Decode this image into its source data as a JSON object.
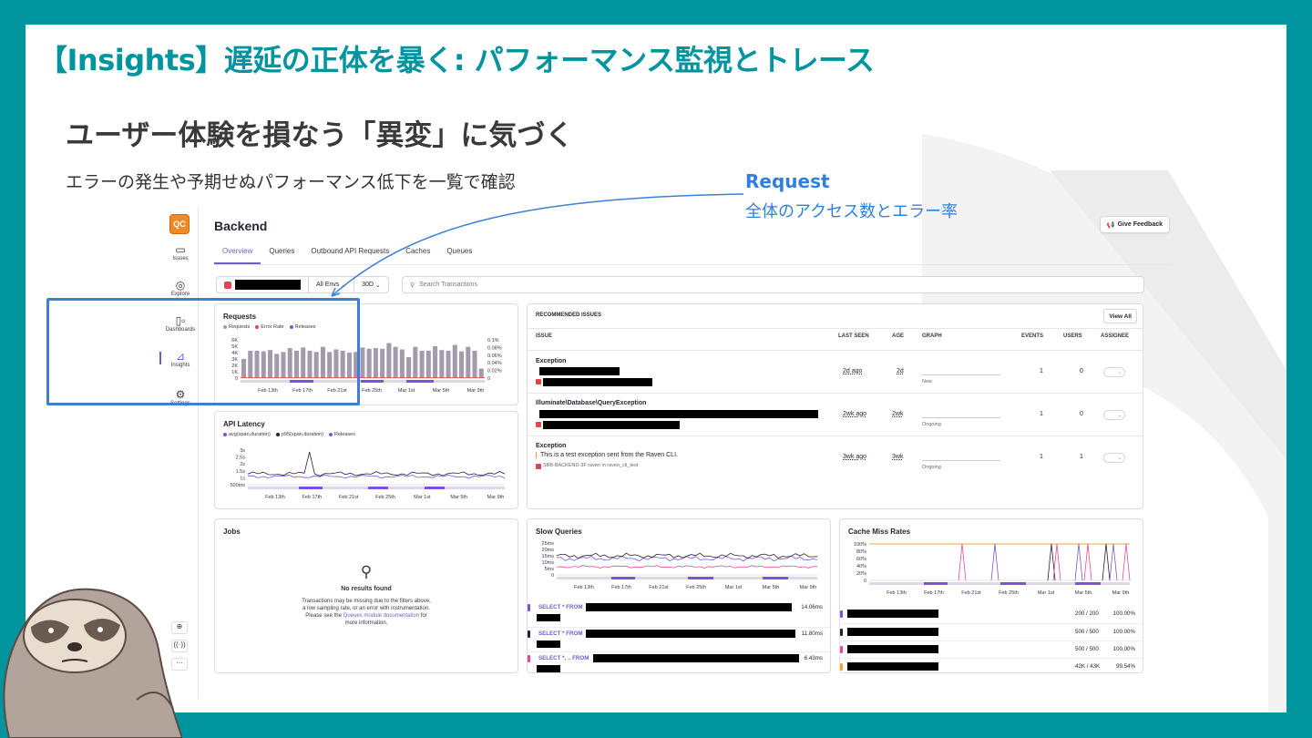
{
  "slide": {
    "title": "【Insights】遅延の正体を暴く: パフォーマンス監視とトレース",
    "subtitle": "ユーザー体験を損なう「異変」に気づく",
    "description": "エラーの発生や予期せぬパフォーマンス低下を一覧で確認",
    "callout_title": "Request",
    "callout_sub": "全体のアクセス数とエラー率",
    "accent_color": "#00949f",
    "callout_color": "#2f7fe0"
  },
  "sidebar": {
    "logo": "QC",
    "items": [
      {
        "label": "Issues",
        "icon": "inbox-icon"
      },
      {
        "label": "Explore",
        "icon": "compass-icon"
      },
      {
        "label": "Dashboards",
        "icon": "dashboard-icon"
      },
      {
        "label": "Insights",
        "icon": "chart-icon"
      },
      {
        "label": "Settings",
        "icon": "gear-icon"
      }
    ],
    "bottom_icons": [
      "help-icon",
      "broadcast-icon",
      "more-icon"
    ]
  },
  "header": {
    "title": "Backend",
    "feedback": "Give Feedback",
    "tabs": [
      "Overview",
      "Queries",
      "Outbound API Requests",
      "Caches",
      "Queues"
    ]
  },
  "filters": {
    "env": "All Envs",
    "period": "30D",
    "search_placeholder": "Search Transactions"
  },
  "requests_panel": {
    "title": "Requests",
    "legend": [
      "Requests",
      "Error Rate",
      "Releases"
    ]
  },
  "latency_panel": {
    "title": "API Latency",
    "legend": [
      "avg(span.duration)",
      "p95(span.duration)",
      "Releases"
    ]
  },
  "issues_panel": {
    "title": "RECOMMENDED ISSUES",
    "view_all": "View All",
    "headers": [
      "ISSUE",
      "LAST SEEN",
      "AGE",
      "GRAPH",
      "EVENTS",
      "USERS",
      "ASSIGNEE"
    ],
    "rows": [
      {
        "title": "Exception",
        "message": "",
        "meta": "",
        "last_seen": "2d ago",
        "age": "2d",
        "status": "New",
        "events": "1",
        "users": "0"
      },
      {
        "title": "Illuminate\\Database\\QueryException",
        "message": "",
        "meta": "",
        "last_seen": "2wk ago",
        "age": "2wk",
        "status": "Ongoing",
        "events": "1",
        "users": "0"
      },
      {
        "title": "Exception",
        "message": "This is a test exception sent from the Raven CLI.",
        "meta": "SBB-BACKEND-3F  raven in raven_cli_test",
        "last_seen": "3wk ago",
        "age": "3wk",
        "status": "Ongoing",
        "events": "1",
        "users": "1"
      }
    ]
  },
  "jobs_panel": {
    "title": "Jobs",
    "empty_title": "No results found",
    "empty_line1": "Transactions may be missing due to the filters above,",
    "empty_line2": "a low sampling rate, or an error with instrumentation.",
    "empty_line3a": "Please see the ",
    "empty_link": "Queues module documentation",
    "empty_line3b": " for",
    "empty_line4": "more information."
  },
  "slow_queries_panel": {
    "title": "Slow Queries",
    "rows": [
      {
        "query": "SELECT * FROM",
        "time": "14.06ms",
        "color": "#7b52d9"
      },
      {
        "query": "SELECT * FROM",
        "time": "11.80ms",
        "color": "#2b1d38"
      },
      {
        "query": "SELECT *, .. FROM",
        "time": "6.43ms",
        "color": "#e8489a"
      }
    ]
  },
  "cache_panel": {
    "title": "Cache Miss Rates",
    "rows": [
      {
        "count": "200 / 200",
        "rate": "100.00%",
        "color": "#7b52d9"
      },
      {
        "count": "500 / 500",
        "rate": "100.00%",
        "color": "#2b1d38"
      },
      {
        "count": "500 / 500",
        "rate": "100.00%",
        "color": "#e8489a"
      },
      {
        "count": "42K / 43K",
        "rate": "99.54%",
        "color": "#f2a33a"
      }
    ]
  },
  "chart_data": [
    {
      "type": "bar",
      "title": "Requests",
      "x_ticks": [
        "Feb 13th",
        "Feb 17th",
        "Feb 21st",
        "Feb 25th",
        "Mar 1st",
        "Mar 5th",
        "Mar 9th"
      ],
      "y_ticks": [
        "6K",
        "5K",
        "4K",
        "3K",
        "2K",
        "1K",
        "0"
      ],
      "y2_ticks": [
        "0.1%",
        "0.08%",
        "0.06%",
        "0.04%",
        "0.02%",
        "0"
      ],
      "ylim": [
        0,
        6000
      ],
      "series": [
        {
          "name": "Requests",
          "color": "#a49aae",
          "values": [
            3000,
            4300,
            4300,
            4200,
            4400,
            3800,
            4100,
            4700,
            4300,
            4800,
            4300,
            4100,
            4900,
            4100,
            4500,
            4300,
            4000,
            4100,
            4800,
            4600,
            4700,
            4600,
            5500,
            4900,
            4500,
            3300,
            4900,
            4300,
            4300,
            5000,
            4400,
            4300,
            5200,
            4200,
            4900,
            4300,
            1500
          ]
        },
        {
          "name": "Error Rate",
          "color": "#e0474d",
          "values": []
        }
      ]
    },
    {
      "type": "line",
      "title": "API Latency",
      "x_ticks": [
        "Feb 13th",
        "Feb 17th",
        "Feb 21st",
        "Feb 25th",
        "Mar 1st",
        "Mar 5th",
        "Mar 9th"
      ],
      "y_ticks": [
        "3s",
        "2.5s",
        "2s",
        "1.5s",
        "1s",
        "500ms"
      ],
      "series": [
        {
          "name": "avg(span.duration)",
          "color": "#7b52d9"
        },
        {
          "name": "p95(span.duration)",
          "color": "#2b1d38"
        }
      ]
    },
    {
      "type": "line",
      "title": "Slow Queries",
      "x_ticks": [
        "Feb 13th",
        "Feb 17th",
        "Feb 21st",
        "Feb 25th",
        "Mar 1st",
        "Mar 5th",
        "Mar 9th"
      ],
      "y_ticks": [
        "25ms",
        "20ms",
        "15ms",
        "10ms",
        "5ms",
        "0"
      ]
    },
    {
      "type": "line",
      "title": "Cache Miss Rates",
      "x_ticks": [
        "Feb 13th",
        "Feb 17th",
        "Feb 21st",
        "Feb 25th",
        "Mar 1st",
        "Mar 5th",
        "Mar 9th"
      ],
      "y_ticks": [
        "100%",
        "80%",
        "60%",
        "40%",
        "20%",
        "0"
      ]
    }
  ]
}
